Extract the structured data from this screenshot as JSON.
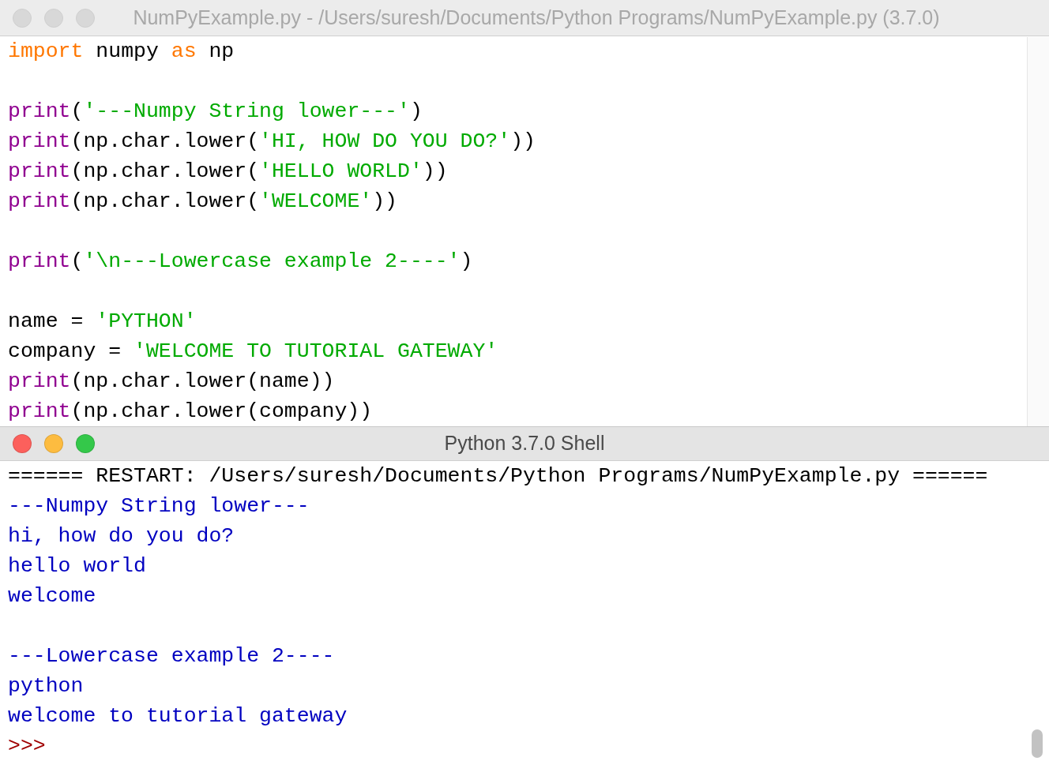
{
  "editor": {
    "title": "NumPyExample.py - /Users/suresh/Documents/Python Programs/NumPyExample.py (3.7.0)",
    "active": false,
    "lines": [
      {
        "kind": "code",
        "tokens": [
          {
            "kind": "keyword",
            "text": "import"
          },
          {
            "kind": "plain",
            "text": " numpy "
          },
          {
            "kind": "keyword",
            "text": "as"
          },
          {
            "kind": "plain",
            "text": " np"
          }
        ]
      },
      {
        "kind": "blank"
      },
      {
        "kind": "code",
        "tokens": [
          {
            "kind": "builtin",
            "text": "print"
          },
          {
            "kind": "plain",
            "text": "("
          },
          {
            "kind": "string",
            "text": "'---Numpy String lower---'"
          },
          {
            "kind": "plain",
            "text": ")"
          }
        ]
      },
      {
        "kind": "code",
        "tokens": [
          {
            "kind": "builtin",
            "text": "print"
          },
          {
            "kind": "plain",
            "text": "(np.char.lower("
          },
          {
            "kind": "string",
            "text": "'HI, HOW DO YOU DO?'"
          },
          {
            "kind": "plain",
            "text": "))"
          }
        ]
      },
      {
        "kind": "code",
        "tokens": [
          {
            "kind": "builtin",
            "text": "print"
          },
          {
            "kind": "plain",
            "text": "(np.char.lower("
          },
          {
            "kind": "string",
            "text": "'HELLO WORLD'"
          },
          {
            "kind": "plain",
            "text": "))"
          }
        ]
      },
      {
        "kind": "code",
        "tokens": [
          {
            "kind": "builtin",
            "text": "print"
          },
          {
            "kind": "plain",
            "text": "(np.char.lower("
          },
          {
            "kind": "string",
            "text": "'WELCOME'"
          },
          {
            "kind": "plain",
            "text": "))"
          }
        ]
      },
      {
        "kind": "blank"
      },
      {
        "kind": "code",
        "tokens": [
          {
            "kind": "builtin",
            "text": "print"
          },
          {
            "kind": "plain",
            "text": "("
          },
          {
            "kind": "string",
            "text": "'\\n---Lowercase example 2----'"
          },
          {
            "kind": "plain",
            "text": ")"
          }
        ]
      },
      {
        "kind": "blank"
      },
      {
        "kind": "code",
        "tokens": [
          {
            "kind": "plain",
            "text": "name = "
          },
          {
            "kind": "string",
            "text": "'PYTHON'"
          }
        ]
      },
      {
        "kind": "code",
        "tokens": [
          {
            "kind": "plain",
            "text": "company = "
          },
          {
            "kind": "string",
            "text": "'WELCOME TO TUTORIAL GATEWAY'"
          }
        ]
      },
      {
        "kind": "code",
        "tokens": [
          {
            "kind": "builtin",
            "text": "print"
          },
          {
            "kind": "plain",
            "text": "(np.char.lower(name))"
          }
        ]
      },
      {
        "kind": "code",
        "tokens": [
          {
            "kind": "builtin",
            "text": "print"
          },
          {
            "kind": "plain",
            "text": "(np.char.lower(company))"
          }
        ]
      }
    ]
  },
  "shell": {
    "title": "Python 3.7.0 Shell",
    "active": true,
    "lines": [
      {
        "kind": "restart",
        "text": "====== RESTART: /Users/suresh/Documents/Python Programs/NumPyExample.py ======"
      },
      {
        "kind": "output",
        "text": "---Numpy String lower---"
      },
      {
        "kind": "output",
        "text": "hi, how do you do?"
      },
      {
        "kind": "output",
        "text": "hello world"
      },
      {
        "kind": "output",
        "text": "welcome"
      },
      {
        "kind": "blank"
      },
      {
        "kind": "output",
        "text": "---Lowercase example 2----"
      },
      {
        "kind": "output",
        "text": "python"
      },
      {
        "kind": "output",
        "text": "welcome to tutorial gateway"
      },
      {
        "kind": "prompt",
        "text": ">>>"
      }
    ]
  }
}
